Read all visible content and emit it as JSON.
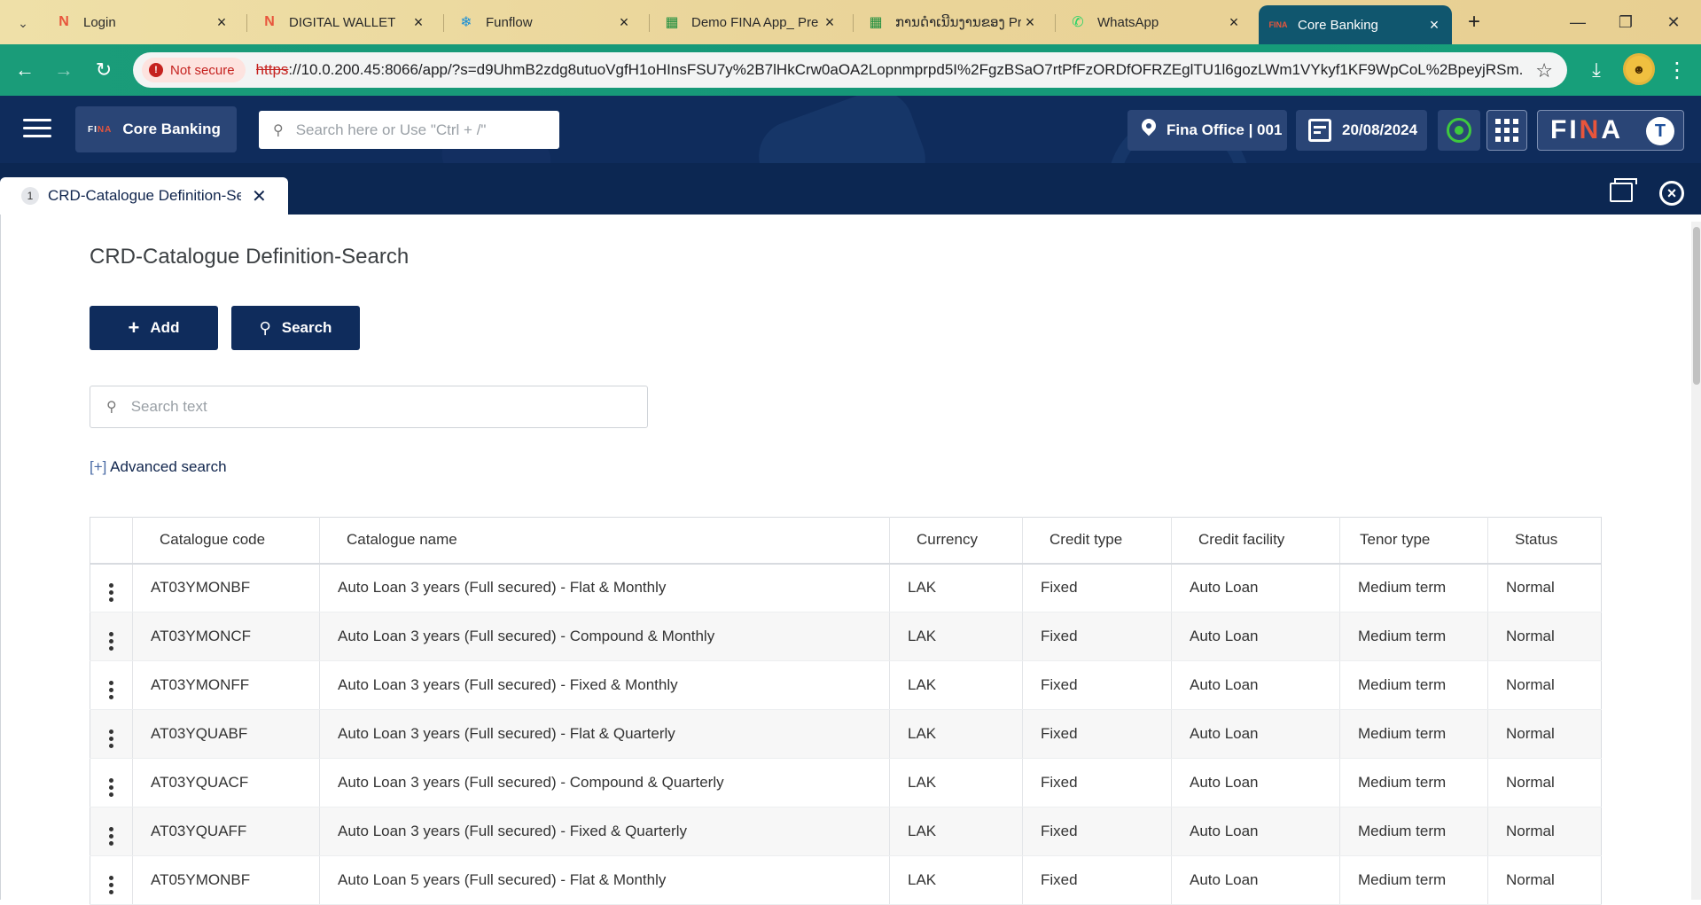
{
  "browser": {
    "tabs": [
      {
        "title": "Login",
        "icon": "n-logo-icon",
        "color": "#e8553c"
      },
      {
        "title": "DIGITAL WALLET",
        "icon": "n-logo-icon",
        "color": "#e8553c"
      },
      {
        "title": "Funflow",
        "icon": "funflow-icon",
        "color": "#1a8fd6"
      },
      {
        "title": "Demo FINA App_ Pre",
        "icon": "sheets-icon",
        "color": "#1e8e3e"
      },
      {
        "title": "ການດຳເນີນງານຂອງ Pro",
        "icon": "sheets-icon",
        "color": "#1e8e3e"
      },
      {
        "title": "WhatsApp",
        "icon": "whatsapp-icon",
        "color": "#25d366"
      },
      {
        "title": "Core Banking",
        "icon": "fina-icon",
        "color": "#e8553c"
      }
    ],
    "security_label": "Not secure",
    "url_scheme": "https",
    "url_rest": "://10.0.200.45:8066/app/?s=d9UhmB2zdg8utuoVgfH1oHInsFSU7y%2B7lHkCrw0aOA2Lopnmprpd5I%2FgzBSaO7rtPfFzORDfOFRZEglTU1l6gozLWm1VYkyf1KF9WpCoL%2BpeyjRSm..."
  },
  "app": {
    "brand": "Core Banking",
    "mini_logo_a": "FI",
    "mini_logo_b": "NA",
    "search_placeholder": "Search here or Use \"Ctrl + /\"",
    "office": "Fina Office | 001",
    "date": "20/08/2024",
    "logo_a": "FI",
    "logo_b": "N",
    "logo_c": "A",
    "user_initial": "T"
  },
  "workspace": {
    "tab_number": "1",
    "tab_label": "CRD-Catalogue Definition-Search"
  },
  "page": {
    "title": "CRD-Catalogue Definition-Search",
    "add_label": "Add",
    "search_label": "Search",
    "search_placeholder": "Search text",
    "advanced_bracket": "[+]",
    "advanced_label": "Advanced search"
  },
  "table": {
    "columns": [
      "Catalogue code",
      "Catalogue name",
      "Currency",
      "Credit type",
      "Credit facility",
      "Tenor type",
      "Status"
    ],
    "rows": [
      [
        "AT03YMONBF",
        "Auto Loan 3 years (Full secured) - Flat & Monthly",
        "LAK",
        "Fixed",
        "Auto Loan",
        "Medium term",
        "Normal"
      ],
      [
        "AT03YMONCF",
        "Auto Loan 3 years (Full secured) - Compound & Monthly",
        "LAK",
        "Fixed",
        "Auto Loan",
        "Medium term",
        "Normal"
      ],
      [
        "AT03YMONFF",
        "Auto Loan 3 years (Full secured) - Fixed & Monthly",
        "LAK",
        "Fixed",
        "Auto Loan",
        "Medium term",
        "Normal"
      ],
      [
        "AT03YQUABF",
        "Auto Loan 3 years (Full secured) - Flat & Quarterly",
        "LAK",
        "Fixed",
        "Auto Loan",
        "Medium term",
        "Normal"
      ],
      [
        "AT03YQUACF",
        "Auto Loan 3 years (Full secured) - Compound & Quarterly",
        "LAK",
        "Fixed",
        "Auto Loan",
        "Medium term",
        "Normal"
      ],
      [
        "AT03YQUAFF",
        "Auto Loan 3 years (Full secured) - Fixed & Quarterly",
        "LAK",
        "Fixed",
        "Auto Loan",
        "Medium term",
        "Normal"
      ],
      [
        "AT05YMONBF",
        "Auto Loan 5 years (Full secured) - Flat & Monthly",
        "LAK",
        "Fixed",
        "Auto Loan",
        "Medium term",
        "Normal"
      ]
    ]
  }
}
